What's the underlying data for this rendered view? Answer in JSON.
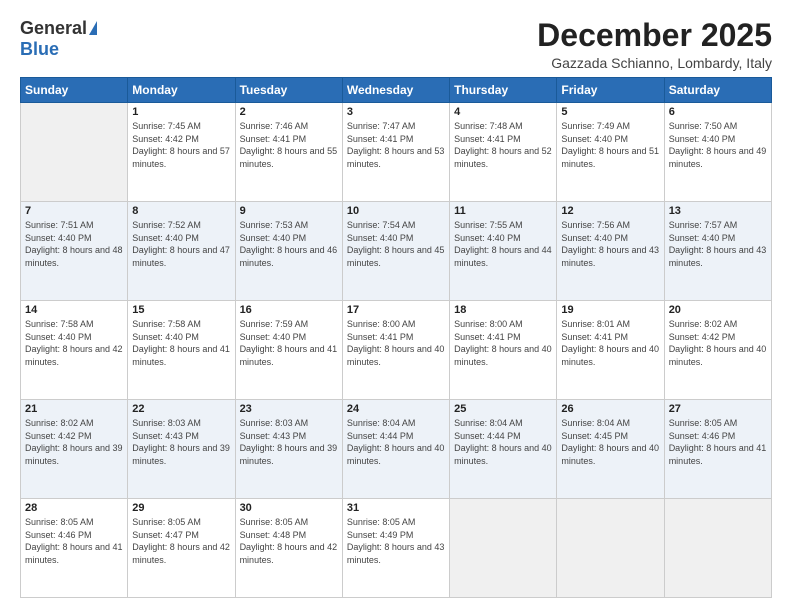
{
  "logo": {
    "general": "General",
    "blue": "Blue"
  },
  "title": "December 2025",
  "location": "Gazzada Schianno, Lombardy, Italy",
  "days": [
    "Sunday",
    "Monday",
    "Tuesday",
    "Wednesday",
    "Thursday",
    "Friday",
    "Saturday"
  ],
  "weeks": [
    [
      {
        "day": "",
        "sunrise": "",
        "sunset": "",
        "daylight": ""
      },
      {
        "day": "1",
        "sunrise": "Sunrise: 7:45 AM",
        "sunset": "Sunset: 4:42 PM",
        "daylight": "Daylight: 8 hours and 57 minutes."
      },
      {
        "day": "2",
        "sunrise": "Sunrise: 7:46 AM",
        "sunset": "Sunset: 4:41 PM",
        "daylight": "Daylight: 8 hours and 55 minutes."
      },
      {
        "day": "3",
        "sunrise": "Sunrise: 7:47 AM",
        "sunset": "Sunset: 4:41 PM",
        "daylight": "Daylight: 8 hours and 53 minutes."
      },
      {
        "day": "4",
        "sunrise": "Sunrise: 7:48 AM",
        "sunset": "Sunset: 4:41 PM",
        "daylight": "Daylight: 8 hours and 52 minutes."
      },
      {
        "day": "5",
        "sunrise": "Sunrise: 7:49 AM",
        "sunset": "Sunset: 4:40 PM",
        "daylight": "Daylight: 8 hours and 51 minutes."
      },
      {
        "day": "6",
        "sunrise": "Sunrise: 7:50 AM",
        "sunset": "Sunset: 4:40 PM",
        "daylight": "Daylight: 8 hours and 49 minutes."
      }
    ],
    [
      {
        "day": "7",
        "sunrise": "Sunrise: 7:51 AM",
        "sunset": "Sunset: 4:40 PM",
        "daylight": "Daylight: 8 hours and 48 minutes."
      },
      {
        "day": "8",
        "sunrise": "Sunrise: 7:52 AM",
        "sunset": "Sunset: 4:40 PM",
        "daylight": "Daylight: 8 hours and 47 minutes."
      },
      {
        "day": "9",
        "sunrise": "Sunrise: 7:53 AM",
        "sunset": "Sunset: 4:40 PM",
        "daylight": "Daylight: 8 hours and 46 minutes."
      },
      {
        "day": "10",
        "sunrise": "Sunrise: 7:54 AM",
        "sunset": "Sunset: 4:40 PM",
        "daylight": "Daylight: 8 hours and 45 minutes."
      },
      {
        "day": "11",
        "sunrise": "Sunrise: 7:55 AM",
        "sunset": "Sunset: 4:40 PM",
        "daylight": "Daylight: 8 hours and 44 minutes."
      },
      {
        "day": "12",
        "sunrise": "Sunrise: 7:56 AM",
        "sunset": "Sunset: 4:40 PM",
        "daylight": "Daylight: 8 hours and 43 minutes."
      },
      {
        "day": "13",
        "sunrise": "Sunrise: 7:57 AM",
        "sunset": "Sunset: 4:40 PM",
        "daylight": "Daylight: 8 hours and 43 minutes."
      }
    ],
    [
      {
        "day": "14",
        "sunrise": "Sunrise: 7:58 AM",
        "sunset": "Sunset: 4:40 PM",
        "daylight": "Daylight: 8 hours and 42 minutes."
      },
      {
        "day": "15",
        "sunrise": "Sunrise: 7:58 AM",
        "sunset": "Sunset: 4:40 PM",
        "daylight": "Daylight: 8 hours and 41 minutes."
      },
      {
        "day": "16",
        "sunrise": "Sunrise: 7:59 AM",
        "sunset": "Sunset: 4:40 PM",
        "daylight": "Daylight: 8 hours and 41 minutes."
      },
      {
        "day": "17",
        "sunrise": "Sunrise: 8:00 AM",
        "sunset": "Sunset: 4:41 PM",
        "daylight": "Daylight: 8 hours and 40 minutes."
      },
      {
        "day": "18",
        "sunrise": "Sunrise: 8:00 AM",
        "sunset": "Sunset: 4:41 PM",
        "daylight": "Daylight: 8 hours and 40 minutes."
      },
      {
        "day": "19",
        "sunrise": "Sunrise: 8:01 AM",
        "sunset": "Sunset: 4:41 PM",
        "daylight": "Daylight: 8 hours and 40 minutes."
      },
      {
        "day": "20",
        "sunrise": "Sunrise: 8:02 AM",
        "sunset": "Sunset: 4:42 PM",
        "daylight": "Daylight: 8 hours and 40 minutes."
      }
    ],
    [
      {
        "day": "21",
        "sunrise": "Sunrise: 8:02 AM",
        "sunset": "Sunset: 4:42 PM",
        "daylight": "Daylight: 8 hours and 39 minutes."
      },
      {
        "day": "22",
        "sunrise": "Sunrise: 8:03 AM",
        "sunset": "Sunset: 4:43 PM",
        "daylight": "Daylight: 8 hours and 39 minutes."
      },
      {
        "day": "23",
        "sunrise": "Sunrise: 8:03 AM",
        "sunset": "Sunset: 4:43 PM",
        "daylight": "Daylight: 8 hours and 39 minutes."
      },
      {
        "day": "24",
        "sunrise": "Sunrise: 8:04 AM",
        "sunset": "Sunset: 4:44 PM",
        "daylight": "Daylight: 8 hours and 40 minutes."
      },
      {
        "day": "25",
        "sunrise": "Sunrise: 8:04 AM",
        "sunset": "Sunset: 4:44 PM",
        "daylight": "Daylight: 8 hours and 40 minutes."
      },
      {
        "day": "26",
        "sunrise": "Sunrise: 8:04 AM",
        "sunset": "Sunset: 4:45 PM",
        "daylight": "Daylight: 8 hours and 40 minutes."
      },
      {
        "day": "27",
        "sunrise": "Sunrise: 8:05 AM",
        "sunset": "Sunset: 4:46 PM",
        "daylight": "Daylight: 8 hours and 41 minutes."
      }
    ],
    [
      {
        "day": "28",
        "sunrise": "Sunrise: 8:05 AM",
        "sunset": "Sunset: 4:46 PM",
        "daylight": "Daylight: 8 hours and 41 minutes."
      },
      {
        "day": "29",
        "sunrise": "Sunrise: 8:05 AM",
        "sunset": "Sunset: 4:47 PM",
        "daylight": "Daylight: 8 hours and 42 minutes."
      },
      {
        "day": "30",
        "sunrise": "Sunrise: 8:05 AM",
        "sunset": "Sunset: 4:48 PM",
        "daylight": "Daylight: 8 hours and 42 minutes."
      },
      {
        "day": "31",
        "sunrise": "Sunrise: 8:05 AM",
        "sunset": "Sunset: 4:49 PM",
        "daylight": "Daylight: 8 hours and 43 minutes."
      },
      {
        "day": "",
        "sunrise": "",
        "sunset": "",
        "daylight": ""
      },
      {
        "day": "",
        "sunrise": "",
        "sunset": "",
        "daylight": ""
      },
      {
        "day": "",
        "sunrise": "",
        "sunset": "",
        "daylight": ""
      }
    ]
  ]
}
